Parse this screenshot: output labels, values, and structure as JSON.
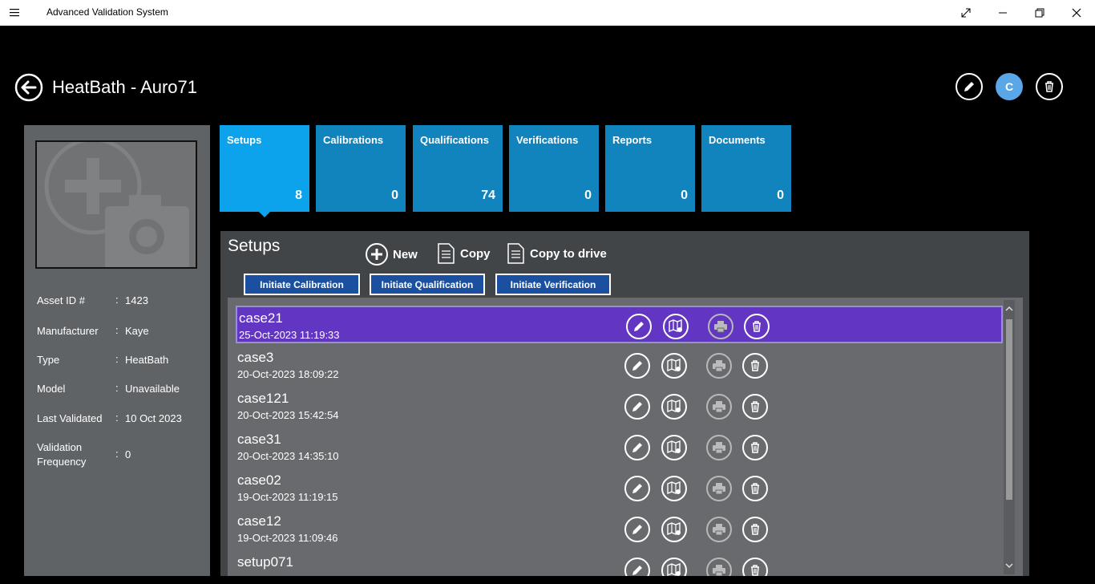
{
  "titlebar": {
    "app_title": "Advanced Validation System"
  },
  "header": {
    "title": "HeatBath - Auro71",
    "avatar_initial": "C"
  },
  "asset": {
    "fields": [
      {
        "label": "Asset ID  #",
        "value": "1423"
      },
      {
        "label": "Manufacturer",
        "value": "Kaye"
      },
      {
        "label": "Type",
        "value": "HeatBath"
      },
      {
        "label": "Model",
        "value": "Unavailable"
      },
      {
        "label": "Last Validated",
        "value": "10 Oct 2023"
      },
      {
        "label": "Validation Frequency",
        "value": "0"
      }
    ]
  },
  "tiles": [
    {
      "label": "Setups",
      "count": "8"
    },
    {
      "label": "Calibrations",
      "count": "0"
    },
    {
      "label": "Qualifications",
      "count": "74"
    },
    {
      "label": "Verifications",
      "count": "0"
    },
    {
      "label": "Reports",
      "count": "0"
    },
    {
      "label": "Documents",
      "count": "0"
    }
  ],
  "main": {
    "title": "Setups",
    "actions": {
      "new": "New",
      "copy": "Copy",
      "copy_to_drive": "Copy to drive"
    },
    "init_buttons": {
      "calibration": "Initiate Calibration",
      "qualification": "Initiate Qualification",
      "verification": "Initiate Verification"
    },
    "rows": [
      {
        "name": "case21",
        "date": "25-Oct-2023 11:19:33"
      },
      {
        "name": "case3",
        "date": "20-Oct-2023 18:09:22"
      },
      {
        "name": "case121",
        "date": "20-Oct-2023 15:42:54"
      },
      {
        "name": "case31",
        "date": "20-Oct-2023 14:35:10"
      },
      {
        "name": "case02",
        "date": "19-Oct-2023 11:19:15"
      },
      {
        "name": "case12",
        "date": "19-Oct-2023 11:09:46"
      },
      {
        "name": "setup071",
        "date": ""
      }
    ]
  },
  "colors": {
    "tile": "#1183bd",
    "tile_active": "#0da2ec",
    "selected_row": "#6236c2",
    "button": "#1b50a0"
  }
}
